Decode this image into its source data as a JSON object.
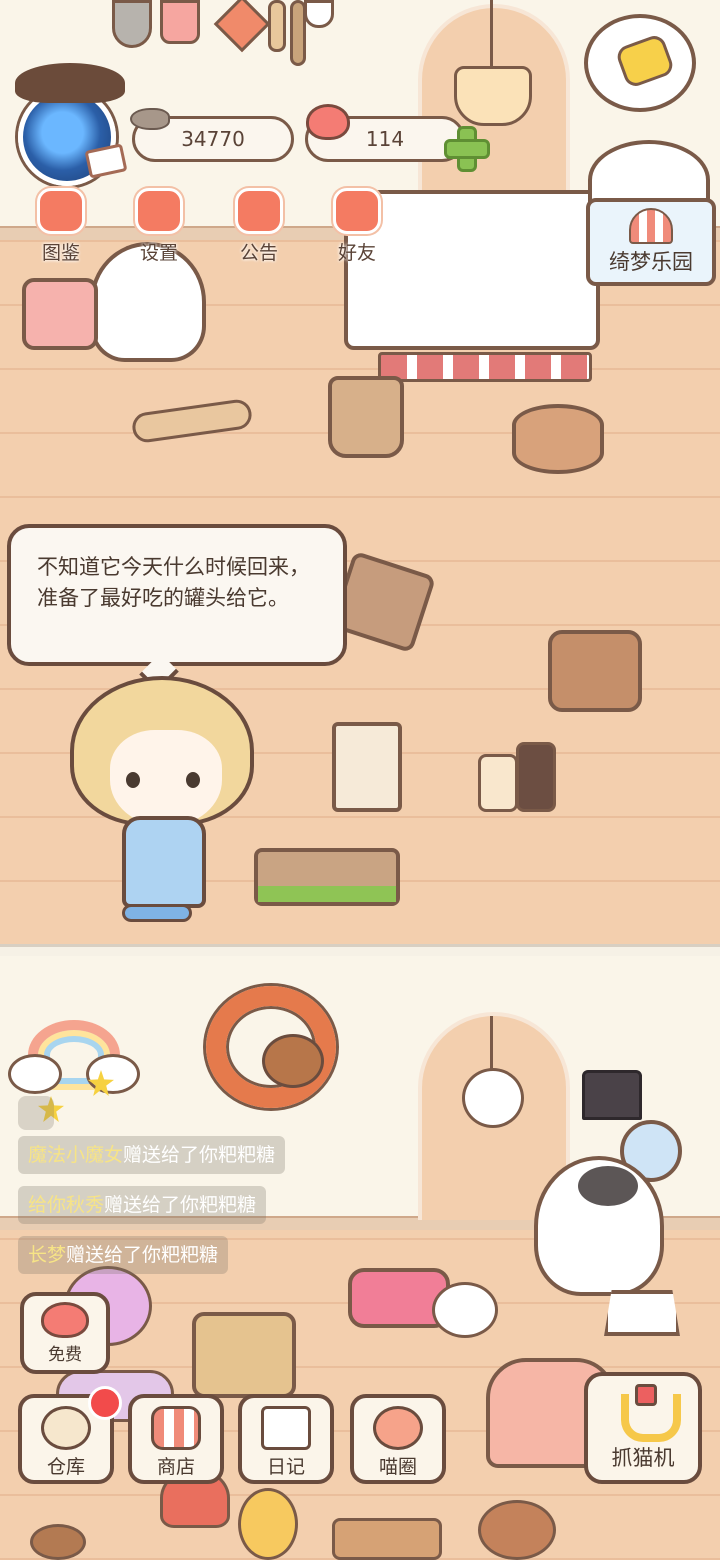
{
  "header": {
    "fish_count": "34770",
    "heart_count": "114"
  },
  "menu": [
    {
      "label": "图鉴",
      "icon": "cat-book-icon",
      "color": "#f47b62"
    },
    {
      "label": "设置",
      "icon": "gear-icon",
      "color": "#f47b62"
    },
    {
      "label": "公告",
      "icon": "gift-icon",
      "color": "#f47b62"
    },
    {
      "label": "好友",
      "icon": "friends-icon",
      "color": "#f47b62"
    }
  ],
  "park_button": {
    "label": "绮梦乐园",
    "icon": "circus-tent-icon"
  },
  "dialogue": {
    "text": "不知道它今天什么时候回来，准备了最好吃的罐头给它。"
  },
  "gift_feed": [
    {
      "sender": "魔法小魔女",
      "message": "赠送给了你粑粑糖"
    },
    {
      "sender": "给你秋秀",
      "message": "赠送给了你粑粑糖"
    },
    {
      "sender": "长梦",
      "message": "赠送给了你粑粑糖"
    }
  ],
  "toolbar": {
    "free": {
      "label": "免费",
      "icon": "heart-face-icon"
    },
    "warehouse": {
      "label": "仓库",
      "icon": "warehouse-icon"
    },
    "shop": {
      "label": "商店",
      "icon": "shop-icon"
    },
    "diary": {
      "label": "日记",
      "icon": "diary-icon"
    },
    "meow_circle": {
      "label": "喵圈",
      "icon": "cat-planet-icon"
    },
    "claw_machine": {
      "label": "抓猫机",
      "icon": "claw-icon"
    }
  },
  "colors": {
    "floor": "#f3cfae",
    "wall": "#faf5e9",
    "accent": "#f47b62",
    "outline": "#6a4c3e",
    "feed_sender": "#f7e486",
    "notification": "#f24b4b"
  }
}
